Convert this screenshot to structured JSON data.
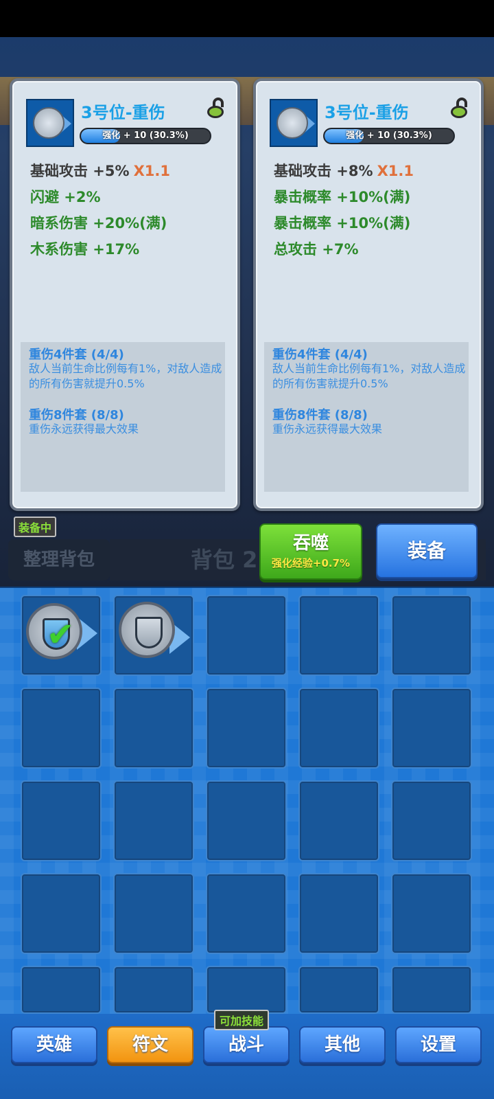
{
  "cards": [
    {
      "title": "3号位-重伤",
      "progress_text": "强化 + 10   (30.3%)",
      "progress_fraction": 0.303,
      "base_stat": "基础攻击 +5%",
      "multiplier": "X1.1",
      "stats": [
        "闪避 +2%",
        "暗系伤害 +20%(满)",
        "木系伤害 +17%"
      ],
      "set4_name": "重伤4件套  (4/4)",
      "set4_desc": "敌人当前生命比例每有1%，对敌人造成的所有伤害就提升0.5%",
      "set8_name": "重伤8件套  (8/8)",
      "set8_desc": "重伤永远获得最大效果"
    },
    {
      "title": "3号位-重伤",
      "progress_text": "强化 + 10   (30.3%)",
      "progress_fraction": 0.303,
      "base_stat": "基础攻击 +8%",
      "multiplier": "X1.1",
      "stats": [
        "暴击概率 +10%(满)",
        "暴击概率 +10%(满)",
        "总攻击 +7%"
      ],
      "set4_name": "重伤4件套  (4/4)",
      "set4_desc": "敌人当前生命比例每有1%，对敌人造成的所有伤害就提升0.5%",
      "set8_name": "重伤8件套  (8/8)",
      "set8_desc": "重伤永远获得最大效果"
    }
  ],
  "equipped_badge": "装备中",
  "sort_button": "整理背包",
  "bag_title": "背包 2",
  "devour_button": {
    "label": "吞噬",
    "sub": "强化经验+0.7%"
  },
  "equip_button": "装备",
  "skill_badge": "可加技能",
  "nav": [
    "英雄",
    "符文",
    "战斗",
    "其他",
    "设置"
  ],
  "nav_active": "符文",
  "colors": {
    "stat_green": "#2d8a2b",
    "title_blue": "#1aa0e6",
    "multiplier_orange": "#e0703b",
    "active_tab": "#f29410"
  },
  "icons": {
    "card_icon": "shield-rune-icon",
    "lock": "unlocked-lock-icon",
    "check": "checkmark-icon"
  }
}
